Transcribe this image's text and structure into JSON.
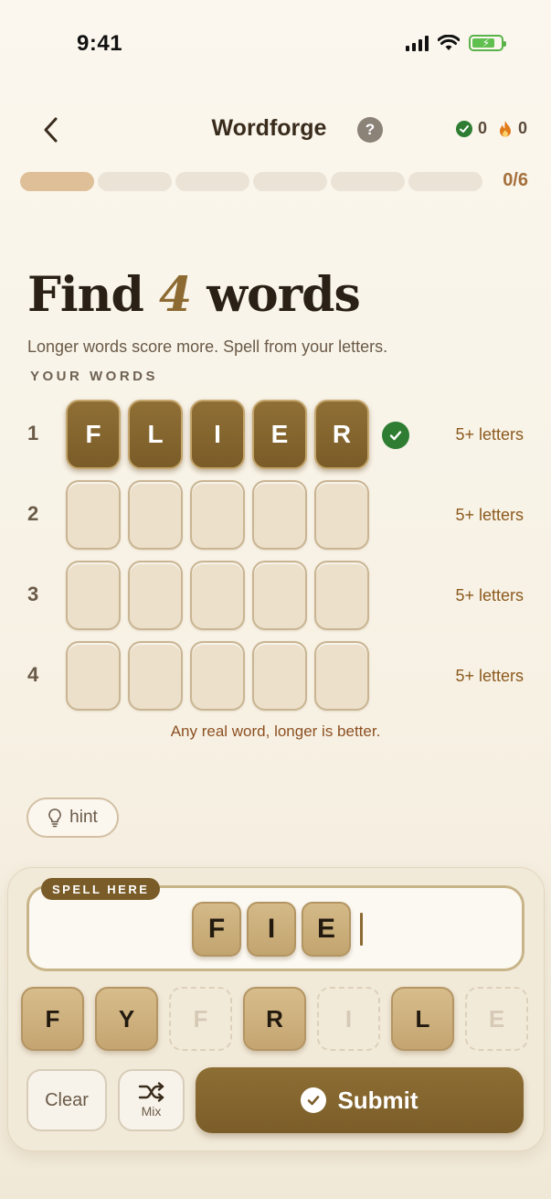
{
  "status_bar": {
    "time": "9:41"
  },
  "header": {
    "title": "Wordforge",
    "help_label": "?",
    "solved_count": "0",
    "streak_count": "0"
  },
  "progress": {
    "filled_segments": 1,
    "total_segments": 6,
    "label": "0/6"
  },
  "heading": {
    "prefix": "Find",
    "number": "4",
    "suffix": "words"
  },
  "subtitle": "Longer words score more. Spell from your letters.",
  "section_label": "YOUR WORDS",
  "rows": [
    {
      "num": "1",
      "letters": [
        "F",
        "L",
        "I",
        "E",
        "R"
      ],
      "solved": true,
      "hint": "5+ letters"
    },
    {
      "num": "2",
      "letters": [
        "",
        "",
        "",
        "",
        ""
      ],
      "solved": false,
      "hint": "5+ letters"
    },
    {
      "num": "3",
      "letters": [
        "",
        "",
        "",
        "",
        ""
      ],
      "solved": false,
      "hint": "5+ letters"
    },
    {
      "num": "4",
      "letters": [
        "",
        "",
        "",
        "",
        ""
      ],
      "solved": false,
      "hint": "5+ letters"
    }
  ],
  "rule_note": "Any real word, longer is better.",
  "hint_button": {
    "label": "hint",
    "icon": "lightbulb-icon"
  },
  "spell": {
    "label": "SPELL HERE",
    "letters": [
      "F",
      "I",
      "E"
    ]
  },
  "letter_keys": [
    {
      "letter": "F",
      "used": false
    },
    {
      "letter": "Y",
      "used": false
    },
    {
      "letter": "F",
      "used": true
    },
    {
      "letter": "R",
      "used": false
    },
    {
      "letter": "I",
      "used": true
    },
    {
      "letter": "L",
      "used": false
    },
    {
      "letter": "E",
      "used": true
    }
  ],
  "actions": {
    "clear_label": "Clear",
    "mix_label": "Mix",
    "submit_label": "Submit"
  },
  "colors": {
    "accent": "#7b5d29",
    "success": "#2e7d32",
    "progress_fill": "#dfbf98",
    "hint_text": "#8c5a1e"
  }
}
